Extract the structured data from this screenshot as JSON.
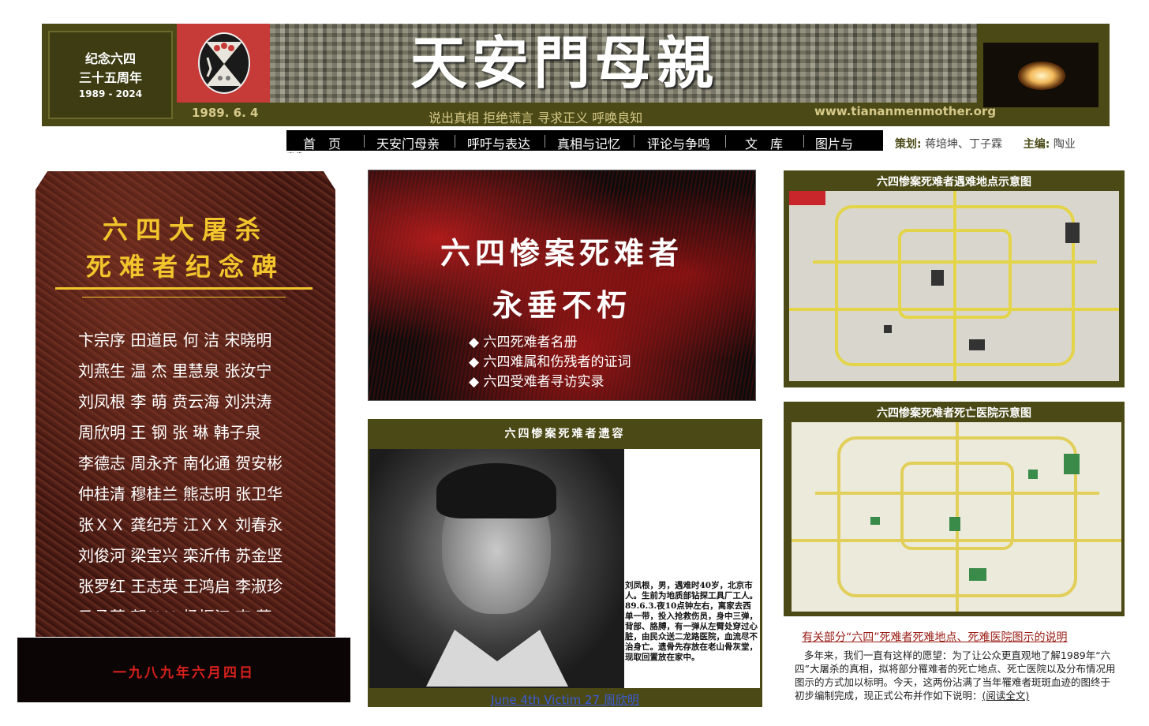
{
  "header": {
    "anniversary_line1": "纪念六四",
    "anniversary_line2": "三十五周年",
    "anniversary_years": "1989 - 2024",
    "site_title": "天安門母親",
    "date": "1989. 6. 4",
    "slogan": "说出真相 拒绝谎言 寻求正义 呼唤良知",
    "url": "www.tiananmenmother.org"
  },
  "nav": {
    "items": [
      "首　页",
      "天安门母亲",
      "呼吁与表达",
      "真相与记忆",
      "评论与争鸣",
      "文　库",
      "图片与"
    ],
    "overflow": "音像"
  },
  "editors": {
    "planner_label": "策划:",
    "planner_names": "蒋培坤、丁子霖",
    "chief_label": "主编:",
    "chief_name": "陶业"
  },
  "monument": {
    "title_line1": "六四大屠杀",
    "title_line2": "死难者纪念碑",
    "names": [
      "卞宗序 田道民 何 洁 宋晓明",
      "刘燕生 温 杰 里慧泉 张汝宁",
      "刘凤根 李 萌 贲云海 刘洪涛",
      "周欣明 王 钢 张 琳 韩子泉",
      "李德志 周永齐 南化通 贺安彬",
      "仲桂清 穆桂兰 熊志明 张卫华",
      "张ＸＸ 龚纪芳 江ＸＸ 刘春永",
      "刘俊河 梁宝兴 栾沂伟 苏金坚",
      "张罗红 王志英 王鸿启 李淑珍",
      "马承芬 郭ＸＸ 杨振江 李 荣"
    ],
    "date": "一九八九年六月四日"
  },
  "victims_card": {
    "title_line1": "六四惨案死难者",
    "title_line2": "永垂不朽",
    "links": [
      "◆ 六四死难者名册",
      "◆ 六四难属和伤残者的证词",
      "◆ 六四受难者寻访实录"
    ]
  },
  "portrait": {
    "title": "六四惨案死难者遗容",
    "caption": "刘凤根，男，遇难时40岁，北京市人。生前为地质部钻探工具厂工人。89.6.3.夜10点钟左右，离家去西单一带，投入抢救伤员，身中三弹，背部、胳膊，有一弹从左臂处穿过心脏，由民众送二龙路医院，血流尽不治身亡。遗骨先存放在老山骨灰堂，现取回置放在家中。",
    "link": "June 4th Victim 27 周欣明"
  },
  "maps": {
    "map1_title": "六四惨案死难者遇难地点示意图",
    "map2_title": "六四惨案死难者死亡医院示意图",
    "explanation_link": "有关部分“六四”死难者死难地点、死难医院图示的说明",
    "description": "多年来，我们一直有这样的愿望：为了让公众更直观地了解1989年“六四”大屠杀的真相，拟将部分罹难者的死亡地点、死亡医院以及分布情况用图示的方式加以标明。今天，这两份沾满了当年罹难者斑斑血迹的图终于初步编制完成，现正式公布并作如下说明：",
    "read_more": "(阅读全文)"
  },
  "colors": {
    "banner_olive": "#4b4a16",
    "gold_text": "#f2c52c",
    "link_blue": "#3b5bd6",
    "link_red": "#9a1c14"
  }
}
